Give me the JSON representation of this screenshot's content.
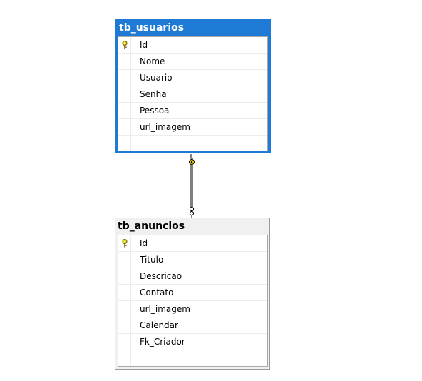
{
  "tables": [
    {
      "title": "tb_usuarios",
      "selected": true,
      "columns": [
        {
          "name": "Id",
          "primary_key": true
        },
        {
          "name": "Nome",
          "primary_key": false
        },
        {
          "name": "Usuario",
          "primary_key": false
        },
        {
          "name": "Senha",
          "primary_key": false
        },
        {
          "name": "Pessoa",
          "primary_key": false
        },
        {
          "name": "url_imagem",
          "primary_key": false
        }
      ]
    },
    {
      "title": "tb_anuncios",
      "selected": false,
      "columns": [
        {
          "name": "Id",
          "primary_key": true
        },
        {
          "name": "Titulo",
          "primary_key": false
        },
        {
          "name": "Descricao",
          "primary_key": false
        },
        {
          "name": "Contato",
          "primary_key": false
        },
        {
          "name": "url_imagem",
          "primary_key": false
        },
        {
          "name": "Calendar",
          "primary_key": false
        },
        {
          "name": "Fk_Criador",
          "primary_key": false
        }
      ]
    }
  ],
  "relationship": {
    "from": "tb_usuarios",
    "to": "tb_anuncios",
    "from_end": "key-icon",
    "to_end": "infinity-icon"
  },
  "colors": {
    "selected_border": "#1f7ad6",
    "key_icon": "#e6d200"
  }
}
